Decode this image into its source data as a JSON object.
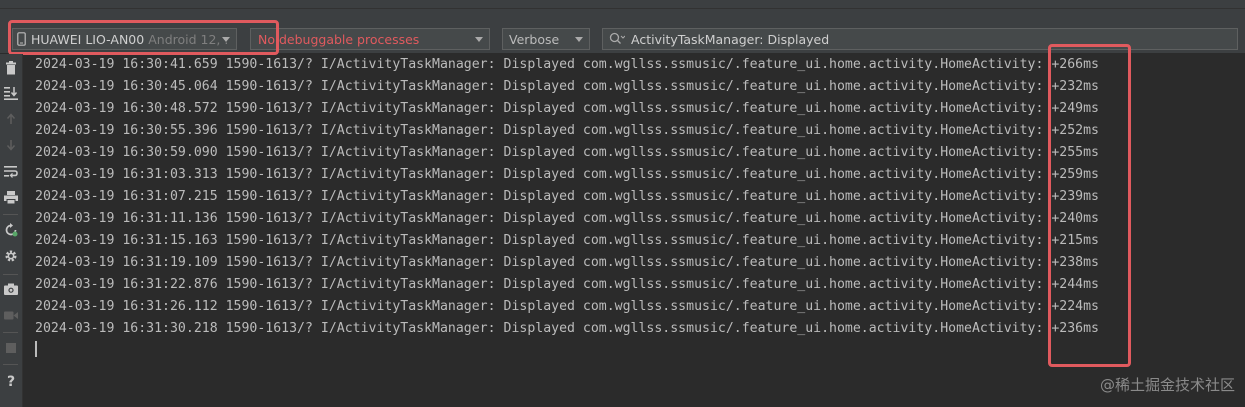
{
  "toolbar": {
    "device": {
      "name": "HUAWEI LIO-AN00",
      "detail": "Android 12, ."
    },
    "process": {
      "label": "No debuggable processes",
      "color": "#e05a5e"
    },
    "log_level": {
      "label": "Verbose"
    },
    "search": {
      "value": "ActivityTaskManager: Displayed"
    }
  },
  "sidebar": {
    "icons": [
      "trash-icon",
      "scroll-to-end-icon",
      "arrow-up-icon",
      "arrow-down-icon",
      "soft-wrap-icon",
      "print-icon",
      "restart-icon",
      "settings-icon",
      "camera-icon",
      "video-icon",
      "stop-icon",
      "help-icon"
    ],
    "help_label": "?"
  },
  "log": {
    "rows": [
      {
        "date": "2024-03-19",
        "time": "16:30:41.659",
        "pid": "1590-1613/?",
        "tag": "I/ActivityTaskManager:",
        "message": "Displayed com.wgllss.ssmusic/.feature_ui.home.activity.HomeActivity:",
        "duration": "+266ms"
      },
      {
        "date": "2024-03-19",
        "time": "16:30:45.064",
        "pid": "1590-1613/?",
        "tag": "I/ActivityTaskManager:",
        "message": "Displayed com.wgllss.ssmusic/.feature_ui.home.activity.HomeActivity:",
        "duration": "+232ms"
      },
      {
        "date": "2024-03-19",
        "time": "16:30:48.572",
        "pid": "1590-1613/?",
        "tag": "I/ActivityTaskManager:",
        "message": "Displayed com.wgllss.ssmusic/.feature_ui.home.activity.HomeActivity:",
        "duration": "+249ms"
      },
      {
        "date": "2024-03-19",
        "time": "16:30:55.396",
        "pid": "1590-1613/?",
        "tag": "I/ActivityTaskManager:",
        "message": "Displayed com.wgllss.ssmusic/.feature_ui.home.activity.HomeActivity:",
        "duration": "+252ms"
      },
      {
        "date": "2024-03-19",
        "time": "16:30:59.090",
        "pid": "1590-1613/?",
        "tag": "I/ActivityTaskManager:",
        "message": "Displayed com.wgllss.ssmusic/.feature_ui.home.activity.HomeActivity:",
        "duration": "+255ms"
      },
      {
        "date": "2024-03-19",
        "time": "16:31:03.313",
        "pid": "1590-1613/?",
        "tag": "I/ActivityTaskManager:",
        "message": "Displayed com.wgllss.ssmusic/.feature_ui.home.activity.HomeActivity:",
        "duration": "+259ms"
      },
      {
        "date": "2024-03-19",
        "time": "16:31:07.215",
        "pid": "1590-1613/?",
        "tag": "I/ActivityTaskManager:",
        "message": "Displayed com.wgllss.ssmusic/.feature_ui.home.activity.HomeActivity:",
        "duration": "+239ms"
      },
      {
        "date": "2024-03-19",
        "time": "16:31:11.136",
        "pid": "1590-1613/?",
        "tag": "I/ActivityTaskManager:",
        "message": "Displayed com.wgllss.ssmusic/.feature_ui.home.activity.HomeActivity:",
        "duration": "+240ms"
      },
      {
        "date": "2024-03-19",
        "time": "16:31:15.163",
        "pid": "1590-1613/?",
        "tag": "I/ActivityTaskManager:",
        "message": "Displayed com.wgllss.ssmusic/.feature_ui.home.activity.HomeActivity:",
        "duration": "+215ms"
      },
      {
        "date": "2024-03-19",
        "time": "16:31:19.109",
        "pid": "1590-1613/?",
        "tag": "I/ActivityTaskManager:",
        "message": "Displayed com.wgllss.ssmusic/.feature_ui.home.activity.HomeActivity:",
        "duration": "+238ms"
      },
      {
        "date": "2024-03-19",
        "time": "16:31:22.876",
        "pid": "1590-1613/?",
        "tag": "I/ActivityTaskManager:",
        "message": "Displayed com.wgllss.ssmusic/.feature_ui.home.activity.HomeActivity:",
        "duration": "+244ms"
      },
      {
        "date": "2024-03-19",
        "time": "16:31:26.112",
        "pid": "1590-1613/?",
        "tag": "I/ActivityTaskManager:",
        "message": "Displayed com.wgllss.ssmusic/.feature_ui.home.activity.HomeActivity:",
        "duration": "+224ms"
      },
      {
        "date": "2024-03-19",
        "time": "16:31:30.218",
        "pid": "1590-1613/?",
        "tag": "I/ActivityTaskManager:",
        "message": "Displayed com.wgllss.ssmusic/.feature_ui.home.activity.HomeActivity:",
        "duration": "+236ms"
      }
    ]
  },
  "watermark": "@稀土掘金技术社区",
  "colors": {
    "background": "#2b2b2b",
    "panel": "#3c3f41",
    "text": "#bbbbbb",
    "highlight": "#e05a5e"
  }
}
